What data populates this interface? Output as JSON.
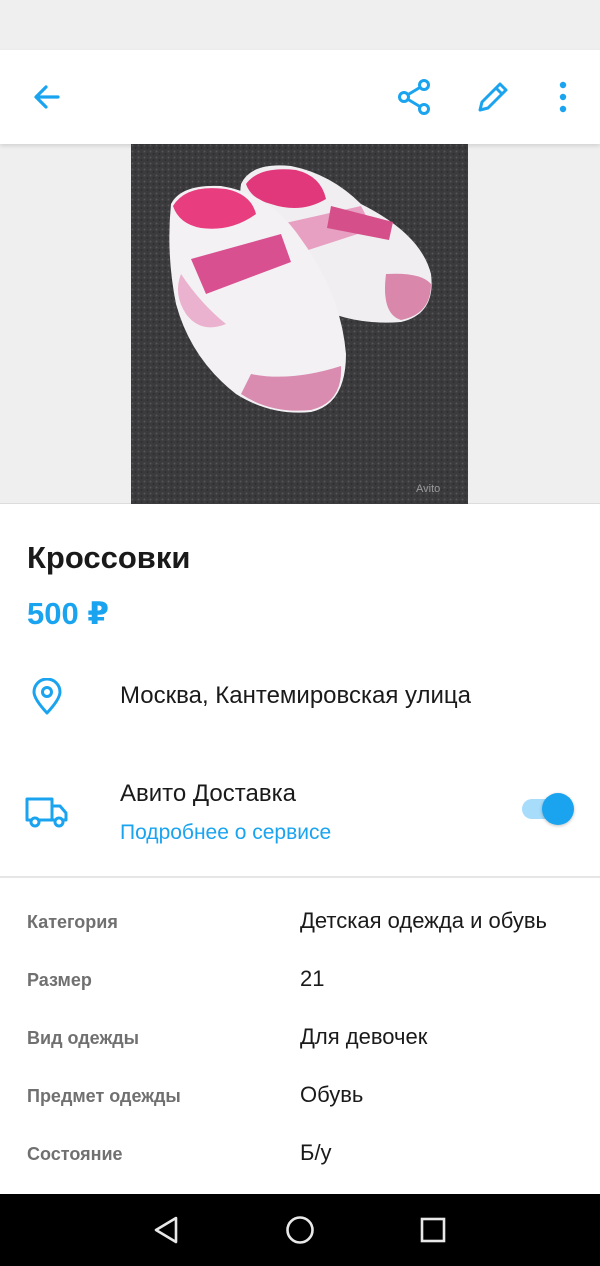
{
  "toolbar": {
    "back_icon": "arrow-left-icon",
    "share_icon": "share-icon",
    "edit_icon": "pencil-icon",
    "more_icon": "more-vertical-icon",
    "accent_color": "#1aa4f0"
  },
  "listing": {
    "title": "Кроссовки",
    "price": "500 ₽",
    "photo_watermark": "Avito"
  },
  "location": {
    "icon": "location-pin-icon",
    "text": "Москва, Кантемировская улица"
  },
  "delivery": {
    "icon": "truck-icon",
    "title": "Авито Доставка",
    "link": "Подробнее о сервисе",
    "toggle_on": true
  },
  "params": [
    {
      "label": "Категория",
      "value": "Детская одежда и обувь"
    },
    {
      "label": "Размер",
      "value": "21"
    },
    {
      "label": "Вид одежды",
      "value": "Для девочек"
    },
    {
      "label": "Предмет одежды",
      "value": "Обувь"
    },
    {
      "label": "Состояние",
      "value": "Б/у"
    }
  ],
  "navbar": {
    "back": "nav-back-icon",
    "home": "nav-home-icon",
    "recents": "nav-recents-icon"
  }
}
